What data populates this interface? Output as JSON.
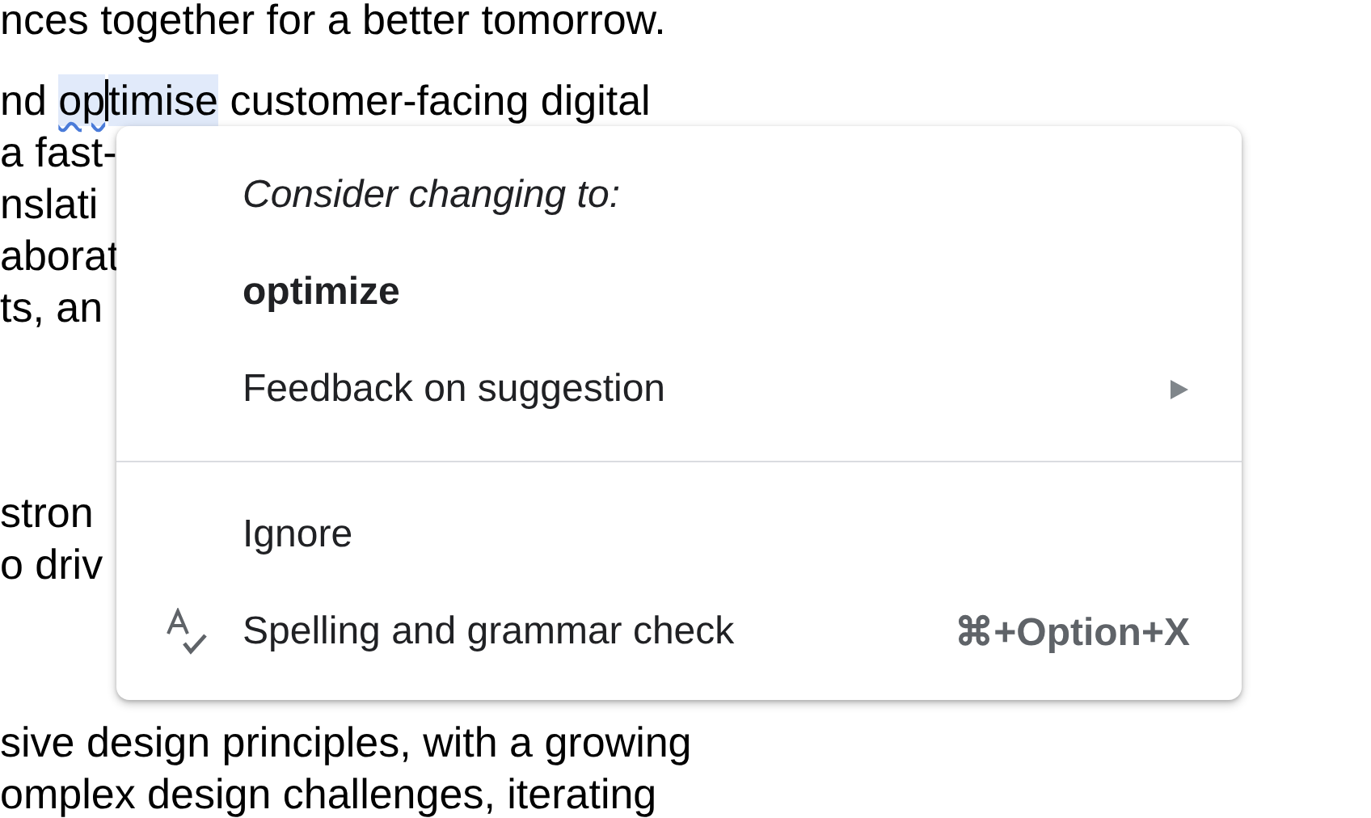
{
  "document": {
    "paragraphs": [
      {
        "lines": [
          [
            {
              "text": "nces together for a better tomorrow."
            }
          ]
        ]
      },
      {
        "lines": [
          [
            {
              "text": "nd "
            },
            {
              "text": "op",
              "highlighted": true,
              "misspelled": true,
              "cursor": true
            },
            {
              "text": "timise",
              "highlighted": true
            },
            {
              "text": " customer-facing digital"
            }
          ],
          [
            {
              "text": "a fast-"
            }
          ],
          [
            {
              "text": "nslati"
            }
          ],
          [
            {
              "text": "aborat"
            }
          ],
          [
            {
              "text": "ts, an"
            }
          ]
        ]
      },
      {
        "lines": [
          [
            {
              "text": "stron"
            }
          ],
          [
            {
              "text": "o driv"
            }
          ]
        ]
      },
      {
        "lines": [
          [
            {
              "text": "sive design principles, with a growing"
            }
          ],
          [
            {
              "text": "omplex design challenges, iterating"
            }
          ]
        ]
      }
    ]
  },
  "context_menu": {
    "items": [
      {
        "kind": "header",
        "label": "Consider changing to:"
      },
      {
        "kind": "suggestion",
        "label": "optimize"
      },
      {
        "kind": "submenu",
        "label": "Feedback on suggestion"
      },
      {
        "kind": "divider"
      },
      {
        "kind": "action",
        "label": "Ignore"
      },
      {
        "kind": "tool",
        "label": "Spelling and grammar check",
        "shortcut": "⌘+Option+X"
      }
    ]
  }
}
